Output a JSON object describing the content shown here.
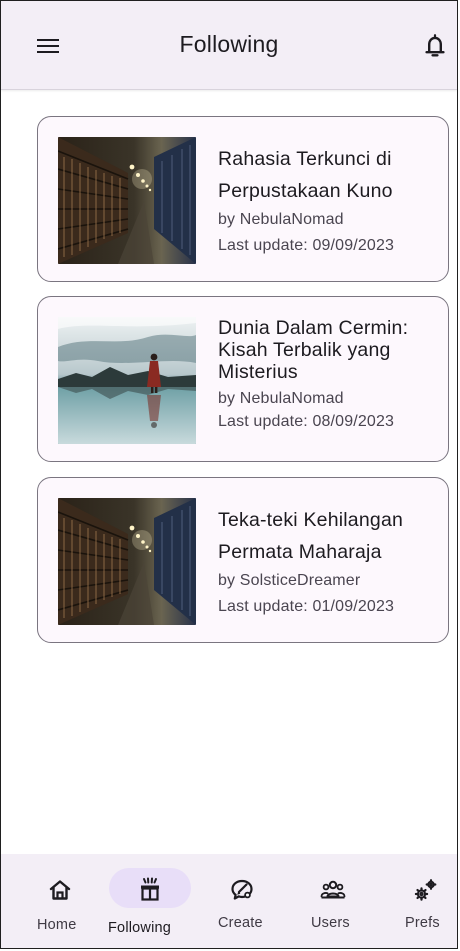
{
  "appbar": {
    "title": "Following",
    "menu_icon": "menu-icon",
    "notification_icon": "bell-icon"
  },
  "stories": [
    {
      "title_line1": "Rahasia Terkunci di",
      "title_line2": "Perpustakaan Kuno",
      "author": "by NebulaNomad",
      "last_update": "Last update: 09/09/2023",
      "image": "library-bookshelves-image"
    },
    {
      "title_line1": "Dunia Dalam Cermin:",
      "title_line2": "Kisah Terbalik yang",
      "title_line3": "Misterius",
      "author": "by NebulaNomad",
      "last_update": "Last update: 08/09/2023",
      "image": "person-standing-in-water-image"
    },
    {
      "title_line1": "Teka-teki Kehilangan",
      "title_line2": "Permata Maharaja",
      "author": "by SolsticeDreamer",
      "last_update": "Last update: 01/09/2023",
      "image": "library-bookshelves-image"
    }
  ],
  "nav": {
    "active": "Following",
    "items": [
      {
        "label": "Home",
        "icon": "home-icon"
      },
      {
        "label": "Following",
        "icon": "following-icon"
      },
      {
        "label": "Create",
        "icon": "create-icon"
      },
      {
        "label": "Users",
        "icon": "users-icon"
      },
      {
        "label": "Prefs",
        "icon": "prefs-icon"
      }
    ]
  },
  "colors": {
    "appbar_bg": "#f3eef6",
    "card_bg": "#fdf8fd",
    "card_border": "#7a7580",
    "active_pill": "#e8def8",
    "text_primary": "#1d1b20",
    "text_secondary": "#4a4550"
  }
}
